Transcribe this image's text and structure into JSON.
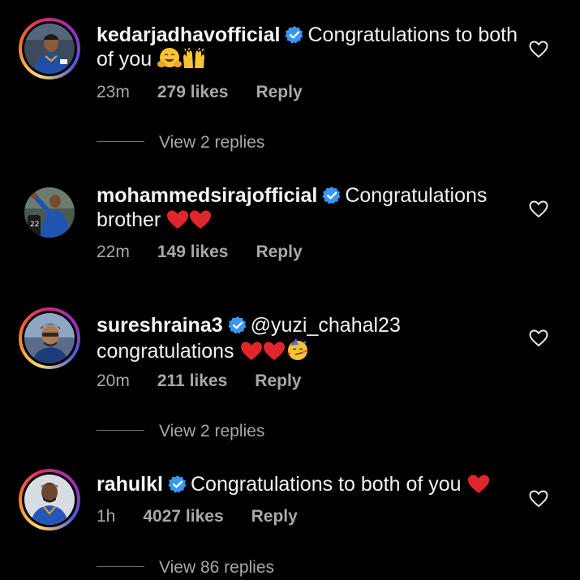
{
  "comments": [
    {
      "username": "kedarjadhavofficial",
      "text": "Congratulations to both of you",
      "emojis": [
        "hugging-face-emoji",
        "raising-hands-emoji"
      ],
      "time": "23m",
      "likes": "279 likes",
      "reply": "Reply",
      "view_replies": "View 2 replies",
      "story_ring": true
    },
    {
      "username": "mohammedsirajofficial",
      "text": "Congratulations brother",
      "emojis": [
        "red-heart-emoji",
        "red-heart-emoji"
      ],
      "time": "22m",
      "likes": "149 likes",
      "reply": "Reply",
      "view_replies": "",
      "story_ring": false
    },
    {
      "username": "sureshraina3",
      "text": "@yuzi_chahal23 congratulations",
      "emojis": [
        "red-heart-emoji",
        "red-heart-emoji",
        "partying-face-emoji"
      ],
      "time": "20m",
      "likes": "211 likes",
      "reply": "Reply",
      "view_replies": "View 2 replies",
      "story_ring": true
    },
    {
      "username": "rahulkl",
      "text": "Congratulations to both of you",
      "emojis": [
        "red-heart-emoji"
      ],
      "time": "1h",
      "likes": "4027 likes",
      "reply": "Reply",
      "view_replies": "View 86 replies",
      "story_ring": true
    }
  ],
  "colors": {
    "background": "#000000",
    "text": "#f5f5f5",
    "secondary_text": "#a8a8a8",
    "verified_badge": "#3897f0",
    "heart_emoji": "#e0262c"
  }
}
